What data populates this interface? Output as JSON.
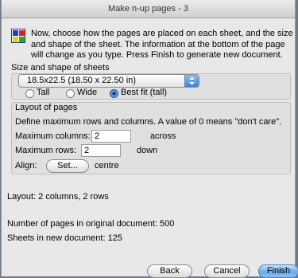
{
  "window": {
    "title": "Make n-up pages - 3"
  },
  "intro": {
    "text": "Now, choose how the pages are placed on each sheet, and the size and shape of the sheet. The information at the bottom of the page will change as you type. Press Finish to generate new document."
  },
  "size_section": {
    "heading": "Size and shape of sheets",
    "selected": "18.5x22.5 (18.50 x 22.50 in)",
    "orientation": {
      "tall": "Tall",
      "wide": "Wide",
      "best_fit": "Best fit (tall)",
      "selected": "best_fit"
    }
  },
  "layout_section": {
    "heading": "Layout of pages",
    "description": "Define maximum rows and columns. A value of 0 means \"don't care\".",
    "max_columns_label": "Maximum columns:",
    "max_columns_value": "2",
    "max_columns_suffix": "across",
    "max_rows_label": "Maximum rows:",
    "max_rows_value": "2",
    "max_rows_suffix": "down",
    "align_label": "Align:",
    "set_button": "Set...",
    "align_value": "centre"
  },
  "info": {
    "layout": "Layout:   2 columns, 2 rows",
    "pages_original": "Number of pages in original document:   500",
    "sheets_new": "Sheets in new document:   125"
  },
  "buttons": {
    "back": "Back",
    "cancel": "Cancel",
    "finish": "Finish"
  }
}
